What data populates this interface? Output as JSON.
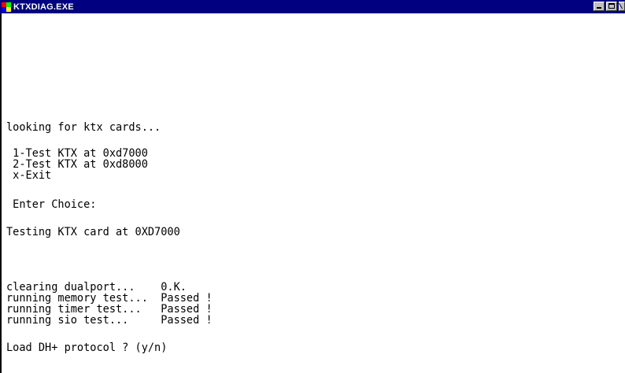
{
  "window": {
    "title": "KTXDIAG.EXE"
  },
  "console": {
    "lines": {
      "looking": "looking for ktx cards...",
      "opt1": " 1-Test KTX at 0xd7000",
      "opt2": " 2-Test KTX at 0xd8000",
      "opt3": " x-Exit",
      "enter": " Enter Choice:",
      "testing": "Testing KTX card at 0XD7000",
      "clearing": "clearing dualport...    0.K.",
      "memory": "running memory test...  Passed !",
      "timer": "running timer test...   Passed !",
      "sio": "running sio test...     Passed !",
      "load": "Load DH+ protocol ? (y/n)"
    }
  }
}
